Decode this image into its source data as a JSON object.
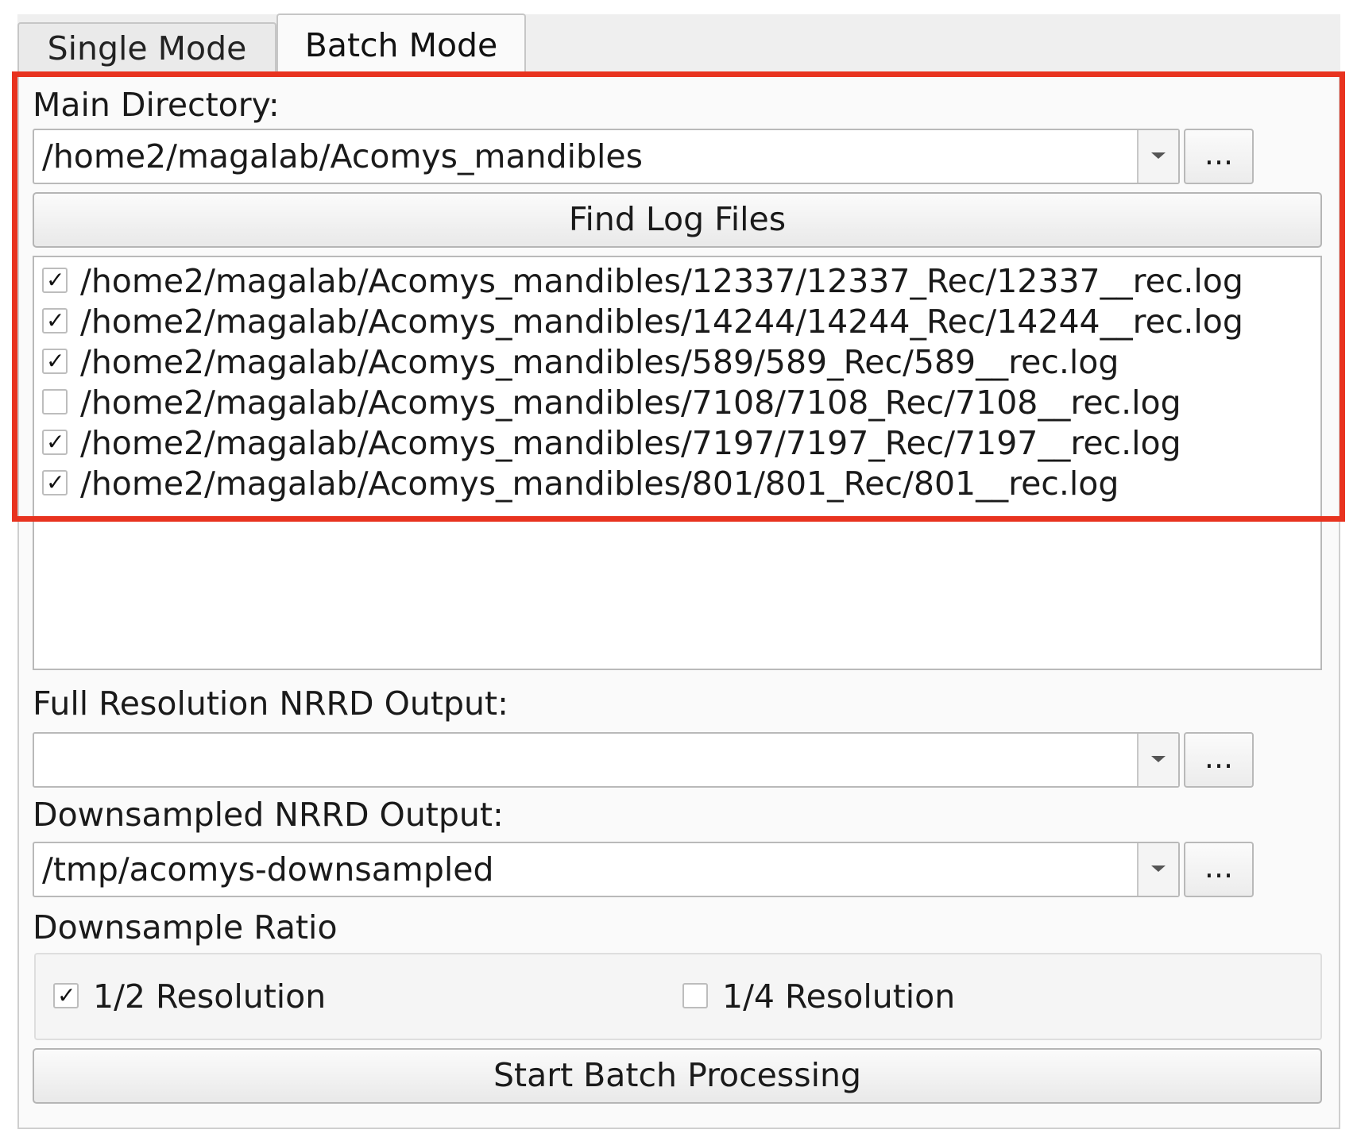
{
  "tabs": [
    {
      "label": "Single Mode",
      "active": false
    },
    {
      "label": "Batch Mode",
      "active": true
    }
  ],
  "main_directory": {
    "label": "Main Directory:",
    "value": "/home2/magalab/Acomys_mandibles",
    "browse_label": "..."
  },
  "find_button": {
    "label": "Find Log Files"
  },
  "log_files": [
    {
      "path": "/home2/magalab/Acomys_mandibles/12337/12337_Rec/12337__rec.log",
      "checked": true
    },
    {
      "path": "/home2/magalab/Acomys_mandibles/14244/14244_Rec/14244__rec.log",
      "checked": true
    },
    {
      "path": "/home2/magalab/Acomys_mandibles/589/589_Rec/589__rec.log",
      "checked": true
    },
    {
      "path": "/home2/magalab/Acomys_mandibles/7108/7108_Rec/7108__rec.log",
      "checked": false
    },
    {
      "path": "/home2/magalab/Acomys_mandibles/7197/7197_Rec/7197__rec.log",
      "checked": true
    },
    {
      "path": "/home2/magalab/Acomys_mandibles/801/801_Rec/801__rec.log",
      "checked": true
    }
  ],
  "full_res_output": {
    "label": "Full Resolution NRRD Output:",
    "value": "",
    "browse_label": "..."
  },
  "downsampled_output": {
    "label": "Downsampled NRRD Output:",
    "value": "/tmp/acomys-downsampled",
    "browse_label": "..."
  },
  "downsample_ratio": {
    "label": "Downsample Ratio",
    "options": [
      {
        "label": "1/2 Resolution",
        "checked": true
      },
      {
        "label": "1/4 Resolution",
        "checked": false
      }
    ]
  },
  "start_button": {
    "label": "Start Batch Processing"
  },
  "colors": {
    "highlight": "#e8331f"
  }
}
